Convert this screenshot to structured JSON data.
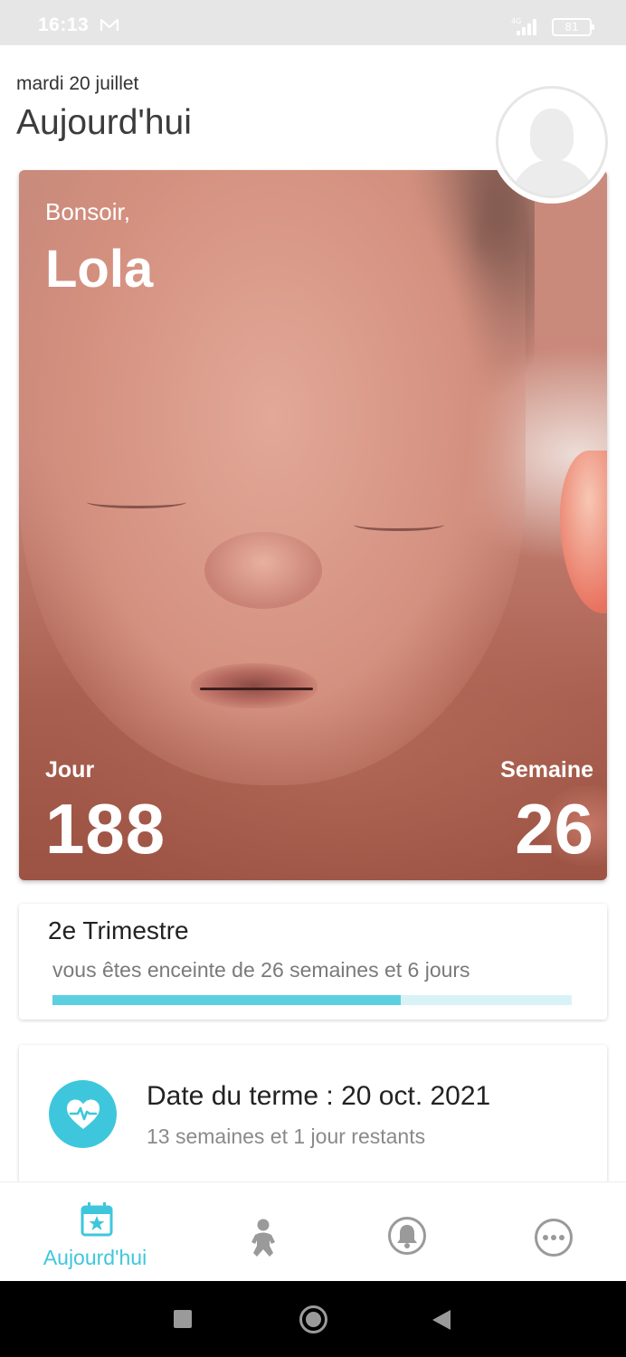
{
  "status_bar": {
    "time": "16:13",
    "network": "4G",
    "battery": "81"
  },
  "header": {
    "date": "mardi 20 juillet",
    "title": "Aujourd'hui"
  },
  "hero": {
    "greeting": "Bonsoir,",
    "name": "Lola",
    "day_label": "Jour",
    "day_value": "188",
    "week_label": "Semaine",
    "week_value": "26"
  },
  "trimester": {
    "title": "2e Trimestre",
    "subtitle": "vous êtes enceinte de 26 semaines et 6 jours",
    "progress_fraction": 0.67
  },
  "due_date": {
    "title": "Date du terme : 20 oct. 2021",
    "subtitle": "13 semaines et 1 jour restants",
    "icon": "heartbeat-icon"
  },
  "bottom_nav": {
    "items": [
      {
        "label": "Aujourd'hui",
        "icon": "calendar-star-icon",
        "active": true
      },
      {
        "label": "",
        "icon": "baby-icon",
        "active": false
      },
      {
        "label": "",
        "icon": "bell-icon",
        "active": false
      },
      {
        "label": "",
        "icon": "more-icon",
        "active": false
      }
    ]
  },
  "colors": {
    "accent": "#3ec7dc",
    "progress_fill": "#5ccfe0",
    "progress_track": "#d9f2f6"
  }
}
